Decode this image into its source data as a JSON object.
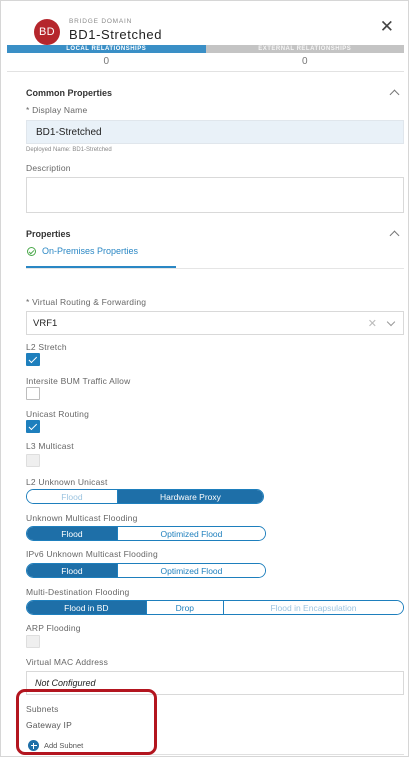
{
  "header": {
    "badge": "BD",
    "object_type": "BRIDGE DOMAIN",
    "object_name": "BD1-Stretched",
    "close_symbol": "✕",
    "close_icon": "close-icon"
  },
  "relationship_tabs": [
    {
      "label": "LOCAL RELATIONSHIPS",
      "count": "0",
      "active": true
    },
    {
      "label": "EXTERNAL RELATIONSHIPS",
      "count": "0",
      "active": false
    }
  ],
  "common_properties": {
    "title": "Common Properties",
    "display_name_label": "* Display Name",
    "display_name_value": "BD1-Stretched",
    "deployed_name": "Deployed Name: BD1-Stretched",
    "description_label": "Description",
    "description_value": ""
  },
  "properties": {
    "title": "Properties",
    "subtab": "On-Premises Properties",
    "vrf_label": "* Virtual Routing & Forwarding",
    "vrf_value": "VRF1",
    "vrf_clear_symbol": "✕",
    "l2_stretch_label": "L2 Stretch",
    "l2_stretch": true,
    "intersite_bum_label": "Intersite BUM Traffic Allow",
    "intersite_bum": false,
    "unicast_routing_label": "Unicast Routing",
    "unicast_routing": true,
    "l3_multicast_label": "L3 Multicast",
    "l3_multicast": false,
    "l2_unknown_unicast": {
      "label": "L2 Unknown Unicast",
      "options": [
        "Flood",
        "Hardware Proxy"
      ],
      "selected": "Hardware Proxy"
    },
    "unknown_multicast_flooding": {
      "label": "Unknown Multicast Flooding",
      "options": [
        "Flood",
        "Optimized Flood"
      ],
      "selected": "Flood"
    },
    "ipv6_unknown_multicast_flooding": {
      "label": "IPv6 Unknown Multicast Flooding",
      "options": [
        "Flood",
        "Optimized Flood"
      ],
      "selected": "Flood"
    },
    "multi_destination_flooding": {
      "label": "Multi-Destination Flooding",
      "options": [
        "Flood in BD",
        "Drop",
        "Flood in Encapsulation"
      ],
      "selected": "Flood in BD"
    },
    "arp_flooding_label": "ARP Flooding",
    "arp_flooding": false,
    "virtual_mac_label": "Virtual MAC Address",
    "virtual_mac_value": "Not Configured"
  },
  "subnets": {
    "title": "Subnets",
    "gateway_ip_label": "Gateway IP",
    "add_label": "Add Subnet"
  },
  "colors": {
    "accent": "#1e7fbd",
    "badge": "#b5262c",
    "highlight": "#b3151f",
    "success": "#4aa84a"
  }
}
